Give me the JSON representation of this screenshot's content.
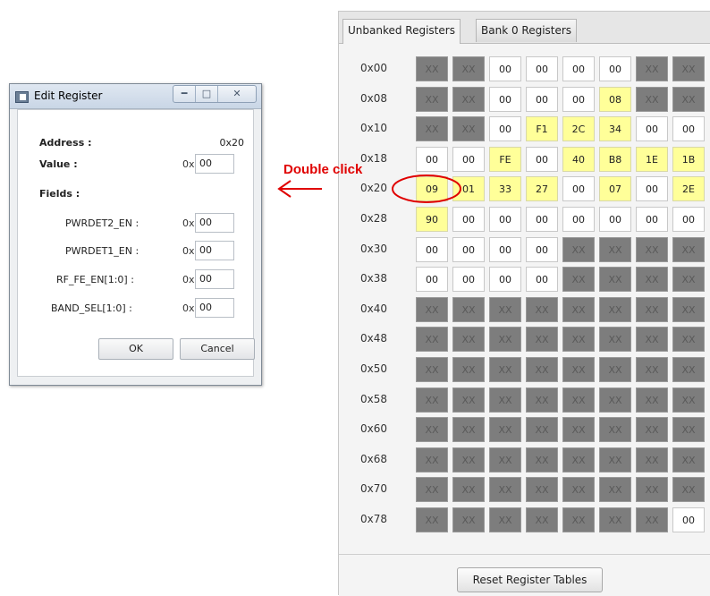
{
  "dialog": {
    "title": "Edit Register",
    "address_label": "Address :",
    "address_value": "0x20",
    "value_label": "Value :",
    "value_prefix": "0x",
    "value": "00",
    "fields_label": "Fields :",
    "fields": [
      {
        "name": "PWRDET2_EN :",
        "prefix": "0x",
        "value": "00"
      },
      {
        "name": "PWRDET1_EN :",
        "prefix": "0x",
        "value": "00"
      },
      {
        "name": "RF_FE_EN[1:0] :",
        "prefix": "0x",
        "value": "00"
      },
      {
        "name": "BAND_SEL[1:0] :",
        "prefix": "0x",
        "value": "00"
      }
    ],
    "ok_label": "OK",
    "cancel_label": "Cancel",
    "icons": {
      "app": "app-window-icon",
      "minimize": "minimize-icon",
      "maximize": "maximize-icon",
      "close": "close-icon"
    }
  },
  "annotation": {
    "text": "Double click",
    "color": "#e00000"
  },
  "register_panel": {
    "tabs": [
      {
        "label": "Unbanked Registers",
        "active": true
      },
      {
        "label": "Bank 0 Registers",
        "active": false
      }
    ],
    "rows": [
      {
        "address": "0x00",
        "cells": [
          "XX",
          "XX",
          "00",
          "00",
          "00",
          "00",
          "XX",
          "XX"
        ],
        "styles": [
          "x",
          "x",
          "w",
          "w",
          "w",
          "w",
          "x",
          "x"
        ]
      },
      {
        "address": "0x08",
        "cells": [
          "XX",
          "XX",
          "00",
          "00",
          "00",
          "08",
          "XX",
          "XX"
        ],
        "styles": [
          "x",
          "x",
          "w",
          "w",
          "w",
          "y",
          "x",
          "x"
        ]
      },
      {
        "address": "0x10",
        "cells": [
          "XX",
          "XX",
          "00",
          "F1",
          "2C",
          "34",
          "00",
          "00"
        ],
        "styles": [
          "x",
          "x",
          "w",
          "y",
          "y",
          "y",
          "w",
          "w"
        ]
      },
      {
        "address": "0x18",
        "cells": [
          "00",
          "00",
          "FE",
          "00",
          "40",
          "B8",
          "1E",
          "1B"
        ],
        "styles": [
          "w",
          "w",
          "y",
          "w",
          "y",
          "y",
          "y",
          "y"
        ]
      },
      {
        "address": "0x20",
        "cells": [
          "09",
          "01",
          "33",
          "27",
          "00",
          "07",
          "00",
          "2E"
        ],
        "styles": [
          "y",
          "y",
          "y",
          "y",
          "w",
          "y",
          "w",
          "y"
        ]
      },
      {
        "address": "0x28",
        "cells": [
          "90",
          "00",
          "00",
          "00",
          "00",
          "00",
          "00",
          "00"
        ],
        "styles": [
          "y",
          "w",
          "w",
          "w",
          "w",
          "w",
          "w",
          "w"
        ]
      },
      {
        "address": "0x30",
        "cells": [
          "00",
          "00",
          "00",
          "00",
          "XX",
          "XX",
          "XX",
          "XX"
        ],
        "styles": [
          "w",
          "w",
          "w",
          "w",
          "x",
          "x",
          "x",
          "x"
        ]
      },
      {
        "address": "0x38",
        "cells": [
          "00",
          "00",
          "00",
          "00",
          "XX",
          "XX",
          "XX",
          "XX"
        ],
        "styles": [
          "w",
          "w",
          "w",
          "w",
          "x",
          "x",
          "x",
          "x"
        ]
      },
      {
        "address": "0x40",
        "cells": [
          "XX",
          "XX",
          "XX",
          "XX",
          "XX",
          "XX",
          "XX",
          "XX"
        ],
        "styles": [
          "x",
          "x",
          "x",
          "x",
          "x",
          "x",
          "x",
          "x"
        ]
      },
      {
        "address": "0x48",
        "cells": [
          "XX",
          "XX",
          "XX",
          "XX",
          "XX",
          "XX",
          "XX",
          "XX"
        ],
        "styles": [
          "x",
          "x",
          "x",
          "x",
          "x",
          "x",
          "x",
          "x"
        ]
      },
      {
        "address": "0x50",
        "cells": [
          "XX",
          "XX",
          "XX",
          "XX",
          "XX",
          "XX",
          "XX",
          "XX"
        ],
        "styles": [
          "x",
          "x",
          "x",
          "x",
          "x",
          "x",
          "x",
          "x"
        ]
      },
      {
        "address": "0x58",
        "cells": [
          "XX",
          "XX",
          "XX",
          "XX",
          "XX",
          "XX",
          "XX",
          "XX"
        ],
        "styles": [
          "x",
          "x",
          "x",
          "x",
          "x",
          "x",
          "x",
          "x"
        ]
      },
      {
        "address": "0x60",
        "cells": [
          "XX",
          "XX",
          "XX",
          "XX",
          "XX",
          "XX",
          "XX",
          "XX"
        ],
        "styles": [
          "x",
          "x",
          "x",
          "x",
          "x",
          "x",
          "x",
          "x"
        ]
      },
      {
        "address": "0x68",
        "cells": [
          "XX",
          "XX",
          "XX",
          "XX",
          "XX",
          "XX",
          "XX",
          "XX"
        ],
        "styles": [
          "x",
          "x",
          "x",
          "x",
          "x",
          "x",
          "x",
          "x"
        ]
      },
      {
        "address": "0x70",
        "cells": [
          "XX",
          "XX",
          "XX",
          "XX",
          "XX",
          "XX",
          "XX",
          "XX"
        ],
        "styles": [
          "x",
          "x",
          "x",
          "x",
          "x",
          "x",
          "x",
          "x"
        ]
      },
      {
        "address": "0x78",
        "cells": [
          "XX",
          "XX",
          "XX",
          "XX",
          "XX",
          "XX",
          "XX",
          "00"
        ],
        "styles": [
          "x",
          "x",
          "x",
          "x",
          "x",
          "x",
          "x",
          "w"
        ]
      }
    ],
    "reset_label": "Reset Register Tables"
  },
  "colors": {
    "unavailable_cell": "#7d7d7d",
    "modified_cell": "#ffff99",
    "default_cell": "#ffffff",
    "annotation": "#e00000"
  }
}
